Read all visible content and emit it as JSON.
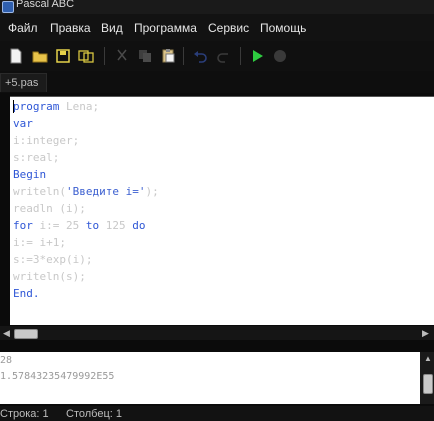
{
  "window": {
    "title": "Pascal ABC"
  },
  "menu": [
    "Файл",
    "Правка",
    "Вид",
    "Программа",
    "Сервис",
    "Помощь"
  ],
  "tab": {
    "label": "+5.pas"
  },
  "code": [
    [
      {
        "t": "program",
        "c": "kw"
      },
      {
        "t": " Lena;",
        "c": "dim"
      }
    ],
    [
      {
        "t": "var",
        "c": "kw"
      }
    ],
    [
      {
        "t": "i:integer;",
        "c": "dim"
      }
    ],
    [
      {
        "t": "s:real;",
        "c": "dim"
      }
    ],
    [
      {
        "t": "Begin",
        "c": "kw"
      }
    ],
    [
      {
        "t": "writeln(",
        "c": "dim"
      },
      {
        "t": "'Введите i='",
        "c": "str"
      },
      {
        "t": ");",
        "c": "dim"
      }
    ],
    [
      {
        "t": "readln (i);",
        "c": "dim"
      }
    ],
    [
      {
        "t": "for",
        "c": "kw"
      },
      {
        "t": " i:= 25 ",
        "c": "dim"
      },
      {
        "t": "to",
        "c": "kw"
      },
      {
        "t": " 125 ",
        "c": "dim"
      },
      {
        "t": "do",
        "c": "kw"
      }
    ],
    [
      {
        "t": "i:= i+1;",
        "c": "dim"
      }
    ],
    [
      {
        "t": "s:=3*exp(i);",
        "c": "dim"
      }
    ],
    [
      {
        "t": "writeln(s);",
        "c": "dim"
      }
    ],
    [
      {
        "t": "End.",
        "c": "kw"
      }
    ]
  ],
  "output": [
    "28",
    "1.57843235479992E55"
  ],
  "status": {
    "row_label": "Строка: 1",
    "col_label": "Столбец: 1"
  }
}
